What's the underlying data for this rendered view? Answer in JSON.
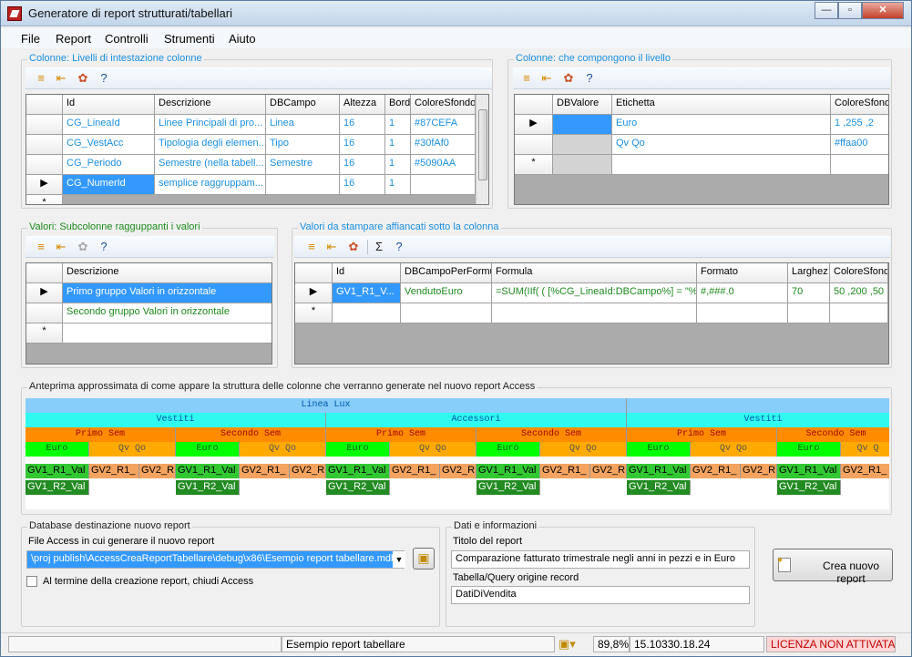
{
  "window": {
    "title": "Generatore di report strutturati/tabellari",
    "min": "—",
    "max": "▫",
    "close": "✕"
  },
  "menu": [
    "File",
    "Report",
    "Controlli",
    "Strumenti",
    "Aiuto"
  ],
  "colonne": {
    "label": "Colonne: Livelli di intestazione colonne",
    "headers": [
      "Id",
      "Descrizione",
      "DBCampo",
      "Altezza",
      "Bord",
      "ColoreSfondo"
    ],
    "rows": [
      [
        "CG_LineaId",
        "Linee Principali di pro...",
        "Linea",
        "16",
        "1",
        "#87CEFA"
      ],
      [
        "CG_VestAcc",
        "Tipologia degli elemen...",
        "Tipo",
        "16",
        "1",
        "#30fAf0"
      ],
      [
        "CG_Periodo",
        "Semestre (nella tabell...",
        "Semestre",
        "16",
        "1",
        "#5090AA"
      ],
      [
        "CG_NumerId",
        "semplice raggruppam...",
        "",
        "16",
        "1",
        ""
      ]
    ]
  },
  "livello": {
    "label": "Colonne: che compongono il livello",
    "headers": [
      "DBValore",
      "Etichetta",
      "ColoreSfondo"
    ],
    "rows": [
      [
        "",
        "Euro",
        "1 ,255 ,2"
      ],
      [
        "",
        "Qv Qo",
        "#ffaa00"
      ]
    ]
  },
  "valori": {
    "label": "Valori: Subcolonne ragguppanti i valori",
    "headers": [
      "Descrizione"
    ],
    "rows": [
      "Primo gruppo Valori in orizzontale",
      "Secondo gruppo Valori in orizzontale"
    ]
  },
  "stampa": {
    "label": "Valori da stampare affiancati sotto la colonna",
    "headers": [
      "Id",
      "DBCampoPerFormu",
      "Formula",
      "Formato",
      "Larghez",
      "ColoreSfondo"
    ],
    "rows": [
      [
        "GV1_R1_V...",
        "VendutoEuro",
        "=SUM(IIf( ( [%CG_LineaId:DBCampo%] = \"%...",
        "#,###.0",
        "70",
        "50 ,200 ,50"
      ]
    ]
  },
  "anteprima": {
    "label": "Anteprima approssimata di come appare la struttura delle colonne che verranno generate nel nuovo report Access",
    "linea": [
      "Linea Lux",
      ""
    ],
    "tipo": [
      "Vestiti",
      "Accessori",
      "Vestiti"
    ],
    "semestre": [
      "Primo Sem",
      "Secondo Sem",
      "Primo Sem",
      "Secondo Sem",
      "Primo Sem",
      "Secondo Sem"
    ],
    "misura": [
      "Euro",
      "Qv Qo",
      "Euro",
      "Qv Qo",
      "Euro",
      "Qv Qo",
      "Euro",
      "Qv Qo",
      "Euro",
      "Qv Q"
    ],
    "r1a": "GV1_R1_Val",
    "r1b": "GV2_R1_",
    "r1c": "GV2_R",
    "r2": "GV1_R2_Val",
    "colors": {
      "linea": "#87cefa",
      "tipo": "#30faf0",
      "sem": "#ff8c00",
      "euro": "#01ff02",
      "qvqo": "#ffaa00",
      "val1": "#32c832",
      "val2": "#f4a460",
      "val3": "#228b22"
    }
  },
  "database": {
    "label": "Database destinazione nuovo report",
    "file_label": "File Access in cui generare il nuovo report",
    "path": "\\proj publish\\AccessCreaReportTabellare\\debug\\x86\\Esempio report tabellare.mdb",
    "checkbox": "Al termine della creazione report,  chiudi Access"
  },
  "dati": {
    "label": "Dati e informazioni",
    "titolo_label": "Titolo del report",
    "titolo": "Comparazione fatturato trimestrale negli anni in pezzi e in Euro",
    "tabella_label": "Tabella/Query origine record",
    "tabella": "DatiDiVendita"
  },
  "crea_button": "Crea nuovo report",
  "status": {
    "report": "Esempio report tabellare",
    "zoom": "89,8%",
    "version": "15.10330.18.24",
    "licenza": "LICENZA NON ATTIVATA"
  }
}
